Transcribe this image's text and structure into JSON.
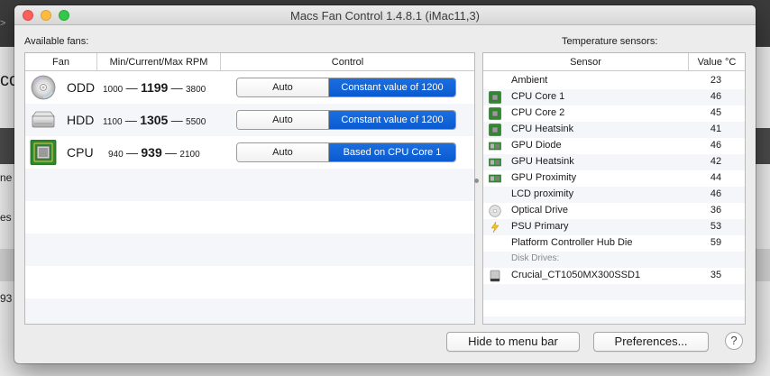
{
  "window": {
    "title": "Macs Fan Control 1.4.8.1 (iMac11,3)"
  },
  "background": {
    "frag_arrow": ">",
    "frag_big": "co",
    "frag_a": "ne",
    "frag_b": "es",
    "frag_c": "93"
  },
  "fans": {
    "section_label": "Available fans:",
    "headers": {
      "fan": "Fan",
      "rpm": "Min/Current/Max RPM",
      "control": "Control"
    },
    "rows": [
      {
        "name": "ODD",
        "icon": "optical-disc-icon",
        "min": "1000",
        "current": "1199",
        "max": "3800",
        "mode_auto": "Auto",
        "mode_selected": "Constant value of 1200"
      },
      {
        "name": "HDD",
        "icon": "hard-drive-icon",
        "min": "1100",
        "current": "1305",
        "max": "5500",
        "mode_auto": "Auto",
        "mode_selected": "Constant value of 1200"
      },
      {
        "name": "CPU",
        "icon": "cpu-chip-icon",
        "min": "940",
        "current": "939",
        "max": "2100",
        "mode_auto": "Auto",
        "mode_selected": "Based on CPU Core 1"
      }
    ],
    "dash": "—"
  },
  "sensors": {
    "section_label": "Temperature sensors:",
    "headers": {
      "sensor": "Sensor",
      "value": "Value °C"
    },
    "rows": [
      {
        "name": "Ambient",
        "value": "23",
        "icon": "none"
      },
      {
        "name": "CPU Core 1",
        "value": "46",
        "icon": "cpu-chip-icon"
      },
      {
        "name": "CPU Core 2",
        "value": "45",
        "icon": "cpu-chip-icon"
      },
      {
        "name": "CPU Heatsink",
        "value": "41",
        "icon": "cpu-chip-icon"
      },
      {
        "name": "GPU Diode",
        "value": "46",
        "icon": "gpu-card-icon"
      },
      {
        "name": "GPU Heatsink",
        "value": "42",
        "icon": "gpu-card-icon"
      },
      {
        "name": "GPU Proximity",
        "value": "44",
        "icon": "gpu-card-icon"
      },
      {
        "name": "LCD proximity",
        "value": "46",
        "icon": "none"
      },
      {
        "name": "Optical Drive",
        "value": "36",
        "icon": "optical-disc-icon"
      },
      {
        "name": "PSU Primary",
        "value": "53",
        "icon": "power-bolt-icon"
      },
      {
        "name": "Platform Controller Hub Die",
        "value": "59",
        "icon": "none"
      }
    ],
    "disk_group_label": "Disk Drives:",
    "disk_rows": [
      {
        "name": "Crucial_CT1050MX300SSD1",
        "value": "35",
        "icon": "ssd-drive-icon"
      }
    ]
  },
  "buttons": {
    "hide": "Hide to menu bar",
    "preferences": "Preferences...",
    "help": "?"
  },
  "colors": {
    "selected_segment": "#0a5bd0",
    "close": "#fc605c",
    "minimize": "#fdbc40",
    "zoom": "#34c84a"
  }
}
